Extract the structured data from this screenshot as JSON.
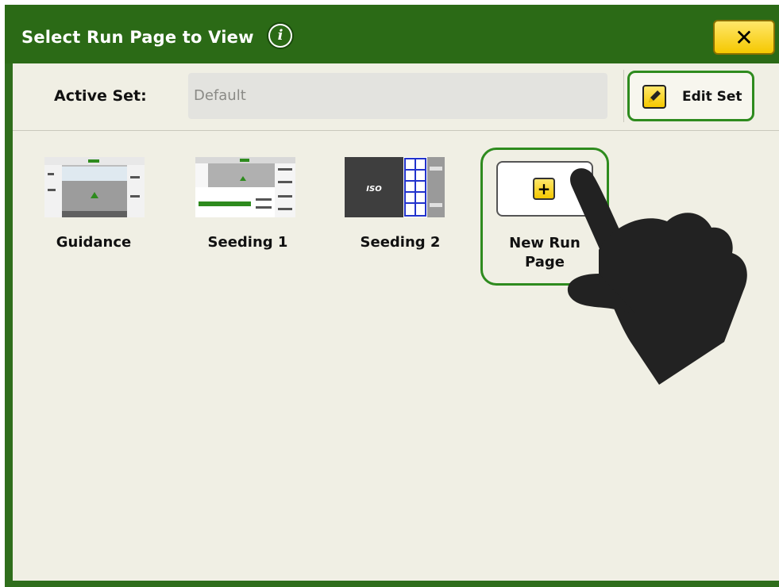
{
  "header": {
    "title": "Select Run Page to View",
    "info_icon": "info-icon",
    "close_icon": "close-icon",
    "accent_color": "#2b6a16",
    "button_color": "#f5c800"
  },
  "active_set": {
    "label": "Active Set:",
    "value": "Default",
    "edit_label": "Edit Set",
    "edit_icon": "pencil-icon"
  },
  "run_pages": [
    {
      "label": "Guidance",
      "thumb": "guidance-thumbnail"
    },
    {
      "label": "Seeding 1",
      "thumb": "seeding-1-thumbnail"
    },
    {
      "label": "Seeding 2",
      "thumb": "seeding-2-thumbnail",
      "thumb_text": "ISO"
    },
    {
      "label": "New Run\nPage",
      "icon": "plus-icon"
    }
  ],
  "overlay": {
    "icon": "pointing-hand-icon"
  }
}
